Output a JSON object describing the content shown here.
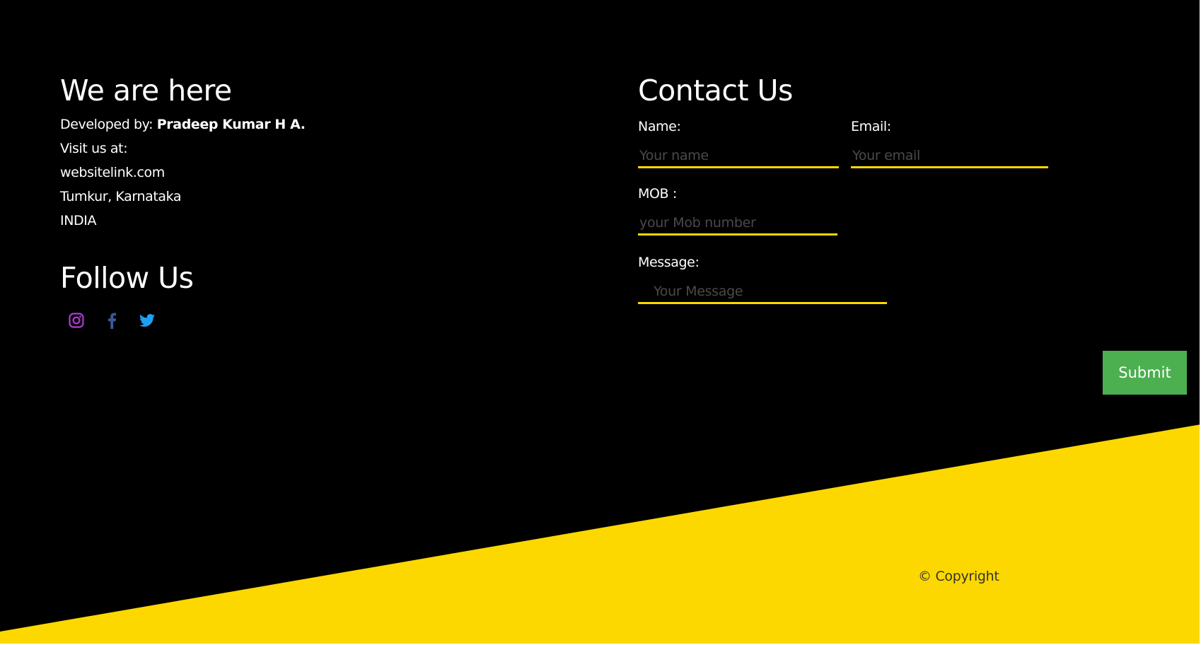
{
  "about": {
    "heading": "We are here",
    "developed_by_label": "Developed by:",
    "developer_name": "Pradeep Kumar H A.",
    "visit_label": "Visit us at:",
    "website": "websitelink.com",
    "location": "Tumkur, Karnataka",
    "country": "INDIA"
  },
  "follow": {
    "heading": "Follow Us",
    "icons": [
      "instagram-icon",
      "facebook-icon",
      "twitter-icon"
    ]
  },
  "contact": {
    "heading": "Contact Us",
    "name_label": "Name:",
    "name_placeholder": "Your name",
    "email_label": "Email:",
    "email_placeholder": "Your email",
    "mob_label": "MOB :",
    "mob_placeholder": "your Mob number",
    "message_label": "Message:",
    "message_placeholder": "Your Message",
    "submit_label": "Submit"
  },
  "footer": {
    "copyright": "© Copyright"
  },
  "colors": {
    "background": "#000000",
    "accent_yellow": "#fdd800",
    "submit_green": "#4caf50",
    "instagram": "#b13ad4",
    "facebook": "#3b5998",
    "twitter": "#1da1f2"
  }
}
